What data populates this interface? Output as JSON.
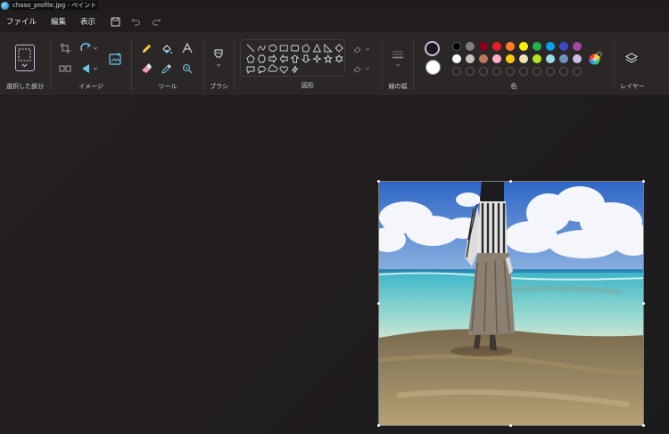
{
  "window": {
    "title": "chaso_profile.jpg - ペイント"
  },
  "menu": {
    "file": "ファイル",
    "edit": "編集",
    "view": "表示"
  },
  "ribbon": {
    "groups": {
      "selection": "選択した部分",
      "image": "イメージ",
      "tools": "ツール",
      "brush": "ブラシ",
      "shapes": "図形",
      "line_width": "線の幅",
      "colors": "色",
      "layers": "レイヤー"
    }
  },
  "colors": {
    "primary": "#1a1a1a",
    "secondary": "#ffffff",
    "palette_row1": [
      "#000000",
      "#7f7f7f",
      "#880015",
      "#ed1c24",
      "#ff7f27",
      "#fff200",
      "#22b14c",
      "#00a2e8",
      "#3f48cc",
      "#a349a4"
    ],
    "palette_row2": [
      "#ffffff",
      "#c3c3c3",
      "#b97a57",
      "#ffaec9",
      "#ffc90e",
      "#efe4b0",
      "#b5e61d",
      "#99d9ea",
      "#7092be",
      "#c8bfe7"
    ]
  },
  "icons": {
    "save": "save-icon",
    "undo": "undo-icon",
    "redo": "redo-icon",
    "selection": "selection-icon",
    "crop": "crop-icon",
    "rotate": "rotate-icon",
    "resize": "resize-icon",
    "flip": "flip-icon",
    "image_ai": "image-ai-icon",
    "pencil": "pencil-icon",
    "fill": "fill-icon",
    "text": "text-icon",
    "eraser": "eraser-icon",
    "picker": "color-picker-icon",
    "zoom": "magnifier-icon",
    "brush": "brush-icon",
    "layers": "layers-icon",
    "palette": "color-wheel-icon"
  }
}
